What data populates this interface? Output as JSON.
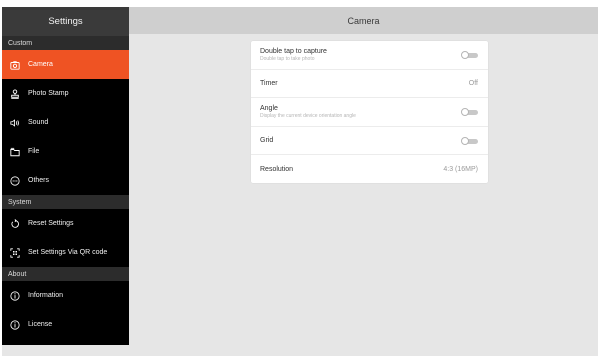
{
  "sidebar": {
    "title": "Settings",
    "sections": [
      {
        "header": "Custom",
        "items": [
          {
            "label": "Camera",
            "icon": "camera-icon",
            "active": true
          },
          {
            "label": "Photo Stamp",
            "icon": "stamp-icon"
          },
          {
            "label": "Sound",
            "icon": "sound-icon"
          },
          {
            "label": "File",
            "icon": "folder-icon"
          },
          {
            "label": "Others",
            "icon": "more-icon"
          }
        ]
      },
      {
        "header": "System",
        "items": [
          {
            "label": "Reset Settings",
            "icon": "reset-icon"
          },
          {
            "label": "Set Settings Via QR code",
            "icon": "qr-scan-icon"
          }
        ]
      },
      {
        "header": "About",
        "items": [
          {
            "label": "Information",
            "icon": "info-icon"
          },
          {
            "label": "License",
            "icon": "info-icon"
          }
        ]
      }
    ]
  },
  "header": {
    "title": "Camera"
  },
  "camera_settings": {
    "double_tap": {
      "label": "Double tap to capture",
      "description": "Double tap to take photo",
      "enabled": false
    },
    "timer": {
      "label": "Timer",
      "value": "Off"
    },
    "angle": {
      "label": "Angle",
      "description": "Display the current device orientation angle",
      "enabled": false
    },
    "grid": {
      "label": "Grid",
      "enabled": false
    },
    "resolution": {
      "label": "Resolution",
      "value": "4:3 (16MP)"
    }
  },
  "colors": {
    "accent": "#ef5323",
    "sidebar_bg": "#000000",
    "content_bg": "#e6e6e6"
  }
}
